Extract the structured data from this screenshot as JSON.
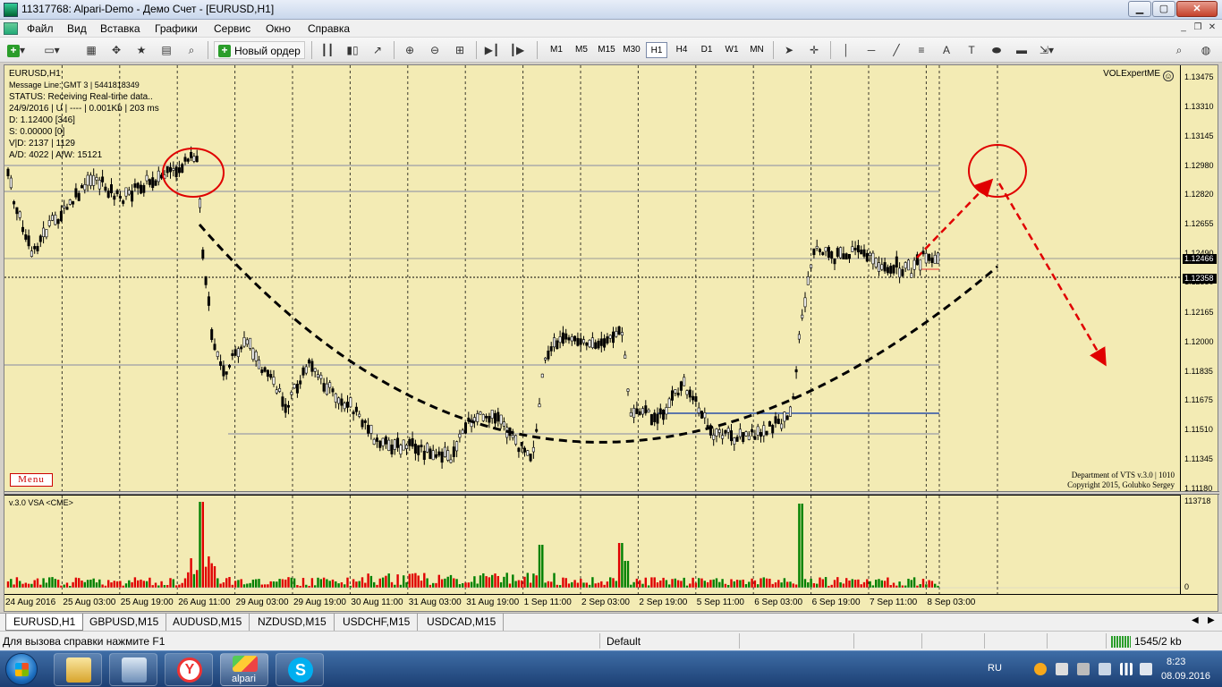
{
  "window": {
    "title": "11317768: Alpari-Demo - Демо Счет - [EURUSD,H1]"
  },
  "menu": [
    "Файл",
    "Вид",
    "Вставка",
    "Графики",
    "Сервис",
    "Окно",
    "Справка"
  ],
  "toolbar": {
    "new_order_label": "Новый ордер",
    "timeframes": [
      "M1",
      "M5",
      "M15",
      "M30",
      "H1",
      "H4",
      "D1",
      "W1",
      "MN"
    ],
    "active_timeframe": "H1"
  },
  "chart": {
    "symbol_label": "EURUSD,H1",
    "info_lines": [
      "Message Line: GMT 3 | 5441818349",
      "STATUS:  Receiving Real-time data..",
      "24/9/2016 | U | ---- | 0.001Kb | 203 ms",
      "D: 1.12400  [346]",
      "S: 0.00000  [0]",
      "V|D: 2137 | 1129",
      "A/D: 4022 | A/W: 15121"
    ],
    "expert_label": "VOLExpertME",
    "menu_button": "Menu",
    "copyright_lines": [
      "Department of VTS  v.3.0 | 1010",
      "Copyright 2015, Golubko Sergey"
    ],
    "indicator_label": "v.3.0 VSA <CME>",
    "volume_axis_max": "113718",
    "volume_axis_min": "0",
    "price_axis_labels": [
      "1.13475",
      "1.13310",
      "1.13145",
      "1.12980",
      "1.12820",
      "1.12655",
      "1.12490",
      "1.12330",
      "1.12165",
      "1.12000",
      "1.11835",
      "1.11675",
      "1.11510",
      "1.11345",
      "1.11180"
    ],
    "current_price": "1.12466",
    "crosshair_price": "1.12358",
    "date_labels": [
      "24 Aug 2016",
      "25 Aug 03:00",
      "25 Aug 19:00",
      "26 Aug 11:00",
      "29 Aug 03:00",
      "29 Aug 19:00",
      "30 Aug 11:00",
      "31 Aug 03:00",
      "31 Aug 19:00",
      "1 Sep 11:00",
      "2 Sep 03:00",
      "2 Sep 19:00",
      "5 Sep 11:00",
      "6 Sep 03:00",
      "6 Sep 19:00",
      "7 Sep 11:00",
      "8 Sep 03:00"
    ],
    "colors": {
      "background": "#f3ebb4",
      "candle": "#000000",
      "volume_up": "#008000",
      "volume_down": "#e00000",
      "annotation": "#e00000",
      "level_line": "#2a4fa8"
    }
  },
  "tabs": [
    "EURUSD,H1",
    "GBPUSD,M15",
    "AUDUSD,M15",
    "NZDUSD,M15",
    "USDCHF,M15",
    "USDCAD,M15"
  ],
  "active_tab": "EURUSD,H1",
  "statusbar": {
    "help_text": "Для вызова справки нажмите F1",
    "profile": "Default",
    "traffic": "1545/2 kb"
  },
  "taskbar": {
    "apps": [
      "windows-explorer",
      "calculator",
      "network",
      "yandex-browser",
      "alpari-terminal",
      "skype"
    ],
    "alpari_label": "alpari",
    "language": "RU",
    "time": "8:23",
    "date": "08.09.2016"
  }
}
